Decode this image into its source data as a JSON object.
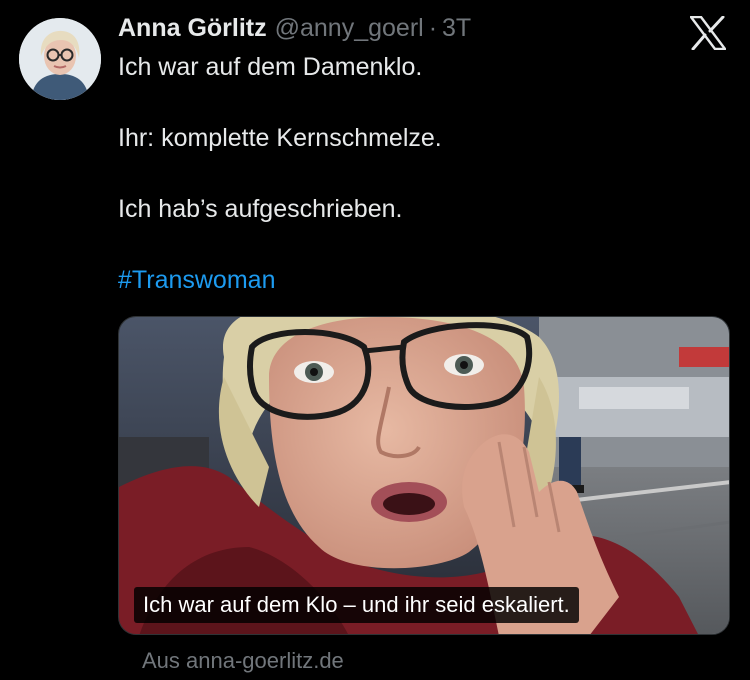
{
  "tweet": {
    "author_name": "Anna Görlitz",
    "handle": "@anny_goerl",
    "separator": "·",
    "time": "3T",
    "lines": [
      "Ich war auf dem Damenklo.",
      "Ihr: komplette Kernschmelze.",
      "Ich hab’s aufgeschrieben."
    ],
    "hashtag": "#Transwoman"
  },
  "media": {
    "caption": "Ich war auf dem Klo – und ihr seid eskaliert."
  },
  "link_source": "Aus anna-goerlitz.de",
  "icons": {
    "platform_logo": "x-logo-icon"
  },
  "colors": {
    "background": "#000000",
    "text": "#e7e9ea",
    "muted": "#71767b",
    "link": "#1d9bf0"
  }
}
